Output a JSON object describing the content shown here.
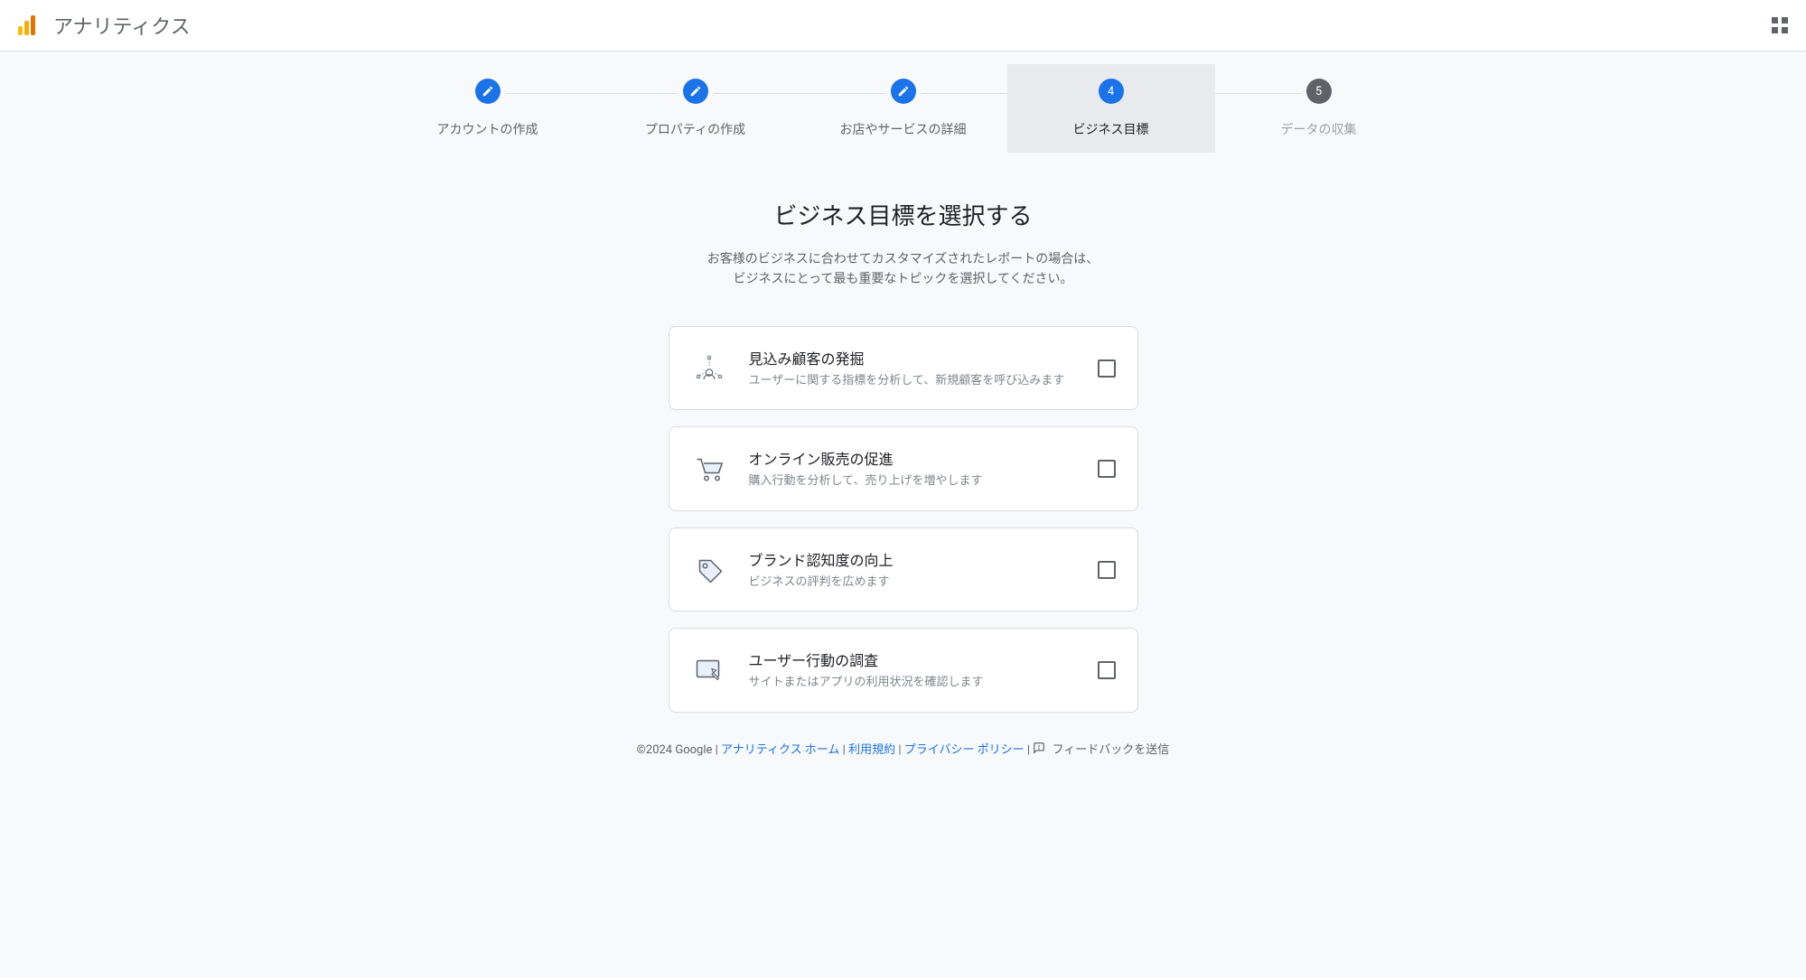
{
  "header": {
    "app_title": "アナリティクス"
  },
  "stepper": {
    "steps": [
      {
        "label": "アカウントの作成",
        "state": "completed"
      },
      {
        "label": "プロパティの作成",
        "state": "completed"
      },
      {
        "label": "お店やサービスの詳細",
        "state": "completed"
      },
      {
        "label": "ビジネス目標",
        "state": "current",
        "number": "4"
      },
      {
        "label": "データの収集",
        "state": "pending",
        "number": "5"
      }
    ]
  },
  "section": {
    "title": "ビジネス目標を選択する",
    "subtitle_line1": "お客様のビジネスに合わせてカスタマイズされたレポートの場合は、",
    "subtitle_line2": "ビジネスにとって最も重要なトピックを選択してください。"
  },
  "options": [
    {
      "title": "見込み顧客の発掘",
      "desc": "ユーザーに関する指標を分析して、新規顧客を呼び込みます",
      "icon": "leads-icon"
    },
    {
      "title": "オンライン販売の促進",
      "desc": "購入行動を分析して、売り上げを増やします",
      "icon": "cart-icon"
    },
    {
      "title": "ブランド認知度の向上",
      "desc": "ビジネスの評判を広めます",
      "icon": "tag-icon"
    },
    {
      "title": "ユーザー行動の調査",
      "desc": "サイトまたはアプリの利用状況を確認します",
      "icon": "screen-icon"
    }
  ],
  "footer": {
    "copyright": "©2024 Google",
    "links": {
      "home": "アナリティクス ホーム",
      "terms": "利用規約",
      "privacy": "プライバシー ポリシー"
    },
    "feedback": "フィードバックを送信",
    "sep": " | "
  }
}
